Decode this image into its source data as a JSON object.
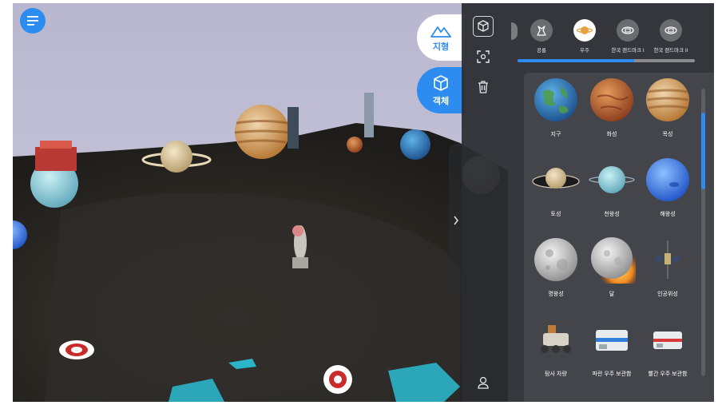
{
  "modes": {
    "terrain_label": "지형",
    "object_label": "객체"
  },
  "categories": [
    {
      "label": "공룡",
      "icon": "dinosaur-icon"
    },
    {
      "label": "우주",
      "icon": "planet-icon",
      "active": true
    },
    {
      "label": "한국 랜드마크 I",
      "icon": "landmark-icon"
    },
    {
      "label": "한국 랜드마크 II",
      "icon": "landmark-icon"
    }
  ],
  "items": [
    "지구",
    "화성",
    "목성",
    "토성",
    "천왕성",
    "해왕성",
    "명왕성",
    "달",
    "인공위성",
    "탐사 차량",
    "파란 우주 보관함",
    "빨간 우주 보관함"
  ],
  "colors": {
    "accent": "#2c8cf0",
    "panel": "#2a2c30"
  }
}
